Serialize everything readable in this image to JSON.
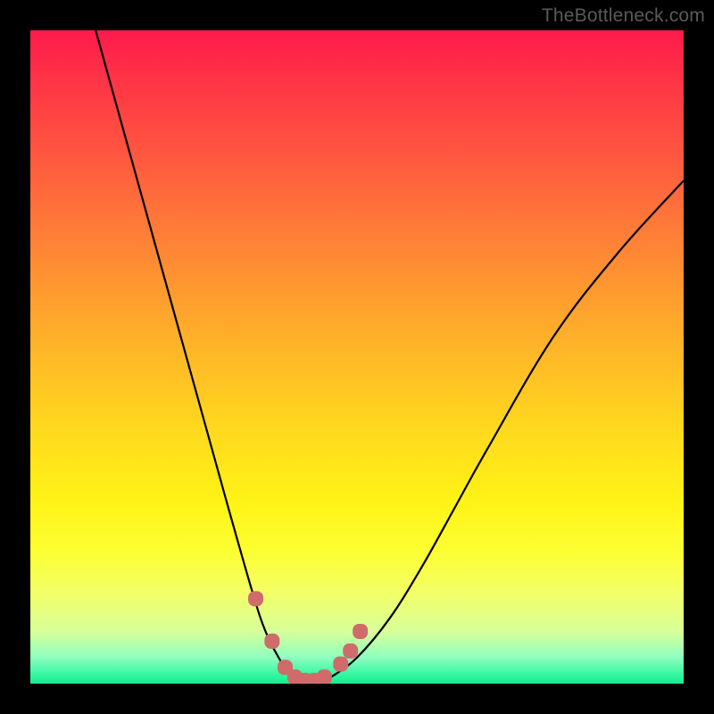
{
  "watermark": "TheBottleneck.com",
  "colors": {
    "frame": "#000000",
    "curve": "#000000",
    "marker": "#cf6b6b",
    "gradient_top": "#ff1a4b",
    "gradient_mid": "#fff316",
    "gradient_bottom": "#1de88f"
  },
  "chart_data": {
    "type": "line",
    "title": "",
    "xlabel": "",
    "ylabel": "",
    "xlim": [
      0,
      100
    ],
    "ylim": [
      0,
      100
    ],
    "grid": false,
    "legend": false,
    "series": [
      {
        "name": "bottleneck-curve",
        "x": [
          10,
          15,
          20,
          25,
          30,
          34,
          36,
          38,
          40,
          42,
          44,
          46,
          50,
          55,
          60,
          65,
          70,
          80,
          90,
          100
        ],
        "values": [
          100,
          82,
          64,
          46,
          28,
          14,
          8,
          4,
          1,
          0,
          0,
          1,
          4,
          10,
          18,
          27,
          36,
          53,
          66,
          77
        ]
      }
    ],
    "annotations": [
      {
        "name": "optimal-markers",
        "style": "rounded-square",
        "color": "#cf6b6b",
        "x": [
          34.5,
          37.0,
          39.0,
          40.5,
          42.0,
          43.5,
          45.0,
          47.5,
          49.0,
          50.5
        ],
        "values": [
          13.0,
          6.5,
          2.5,
          1.0,
          0.5,
          0.5,
          1.0,
          3.0,
          5.0,
          8.0
        ]
      }
    ]
  }
}
